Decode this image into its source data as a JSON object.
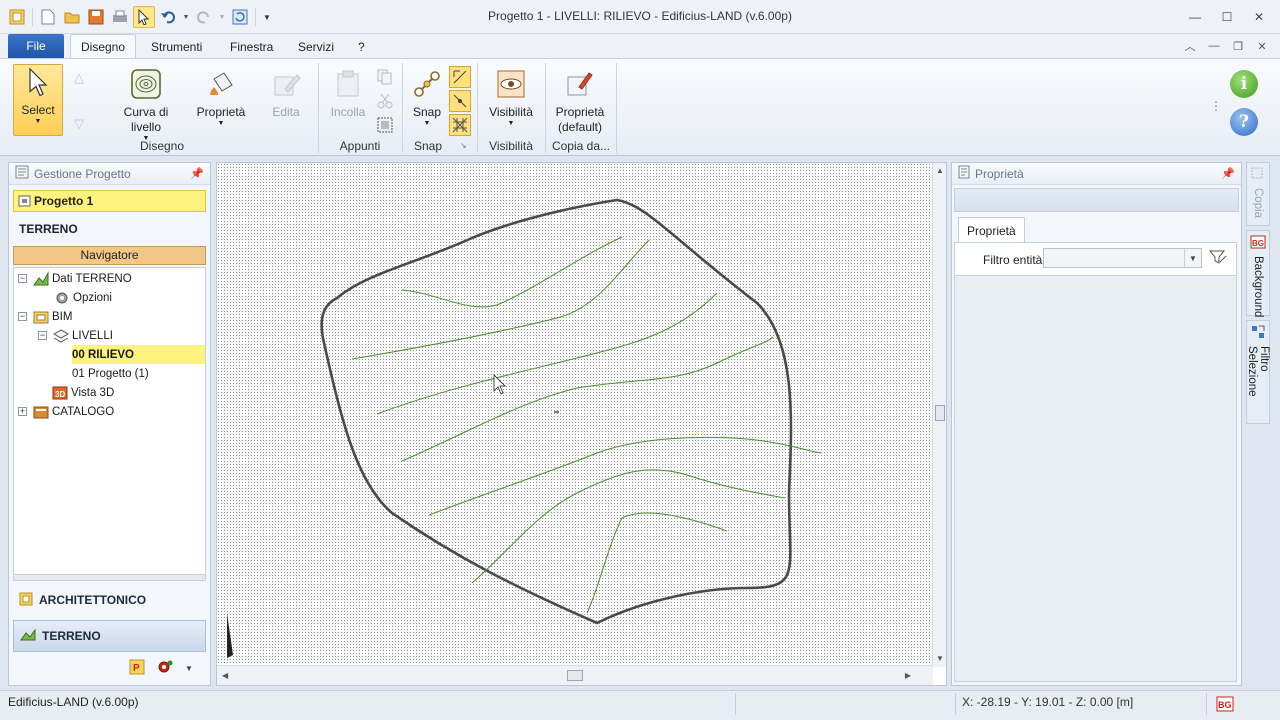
{
  "window": {
    "title": "Progetto 1 - LIVELLI: RILIEVO - Edificius-LAND (v.6.00p)"
  },
  "menu": {
    "file": "File",
    "tabs": [
      "Disegno",
      "Strumenti",
      "Finestra",
      "Servizi",
      "?"
    ]
  },
  "ribbon": {
    "select": "Select",
    "curva_line1": "Curva di",
    "curva_line2": "livello",
    "proprieta": "Proprietà",
    "edita": "Edita",
    "incolla": "Incolla",
    "snap": "Snap",
    "visibilita": "Visibilità",
    "prop_default_line1": "Proprietà",
    "prop_default_line2": "(default)",
    "groups": {
      "disegno": "Disegno",
      "appunti": "Appunti",
      "snap": "Snap",
      "visibilita": "Visibilità",
      "copia": "Copia da..."
    }
  },
  "left_panel": {
    "header": "Gestione Progetto",
    "project": "Progetto 1",
    "section": "TERRENO",
    "navigator": "Navigatore",
    "tree": [
      {
        "label": "Dati TERRENO"
      },
      {
        "label": "Opzioni"
      },
      {
        "label": "BIM"
      },
      {
        "label": "LIVELLI"
      },
      {
        "label": "00 RILIEVO"
      },
      {
        "label": "01 Progetto (1)"
      },
      {
        "label": "Vista 3D"
      },
      {
        "label": "CATALOGO"
      }
    ],
    "bottom_tabs": [
      "ARCHITETTONICO",
      "TERRENO"
    ]
  },
  "right_panel": {
    "header": "Proprietà",
    "tab": "Proprietà",
    "filter_label": "Filtro entità",
    "filter_value": ""
  },
  "side_tabs": [
    "Copia",
    "Background",
    "Filtro Selezione"
  ],
  "status": {
    "left": "Edificius-LAND (v.6.00p)",
    "coords": "X: -28.19 - Y: 19.01 - Z: 0.00 [m]"
  },
  "colors": {
    "accent": "#1f56a6",
    "highlight": "#fff37f",
    "navigator": "#f2c787",
    "contour": "#4b8f2e",
    "boundary": "#4a4a4a"
  }
}
